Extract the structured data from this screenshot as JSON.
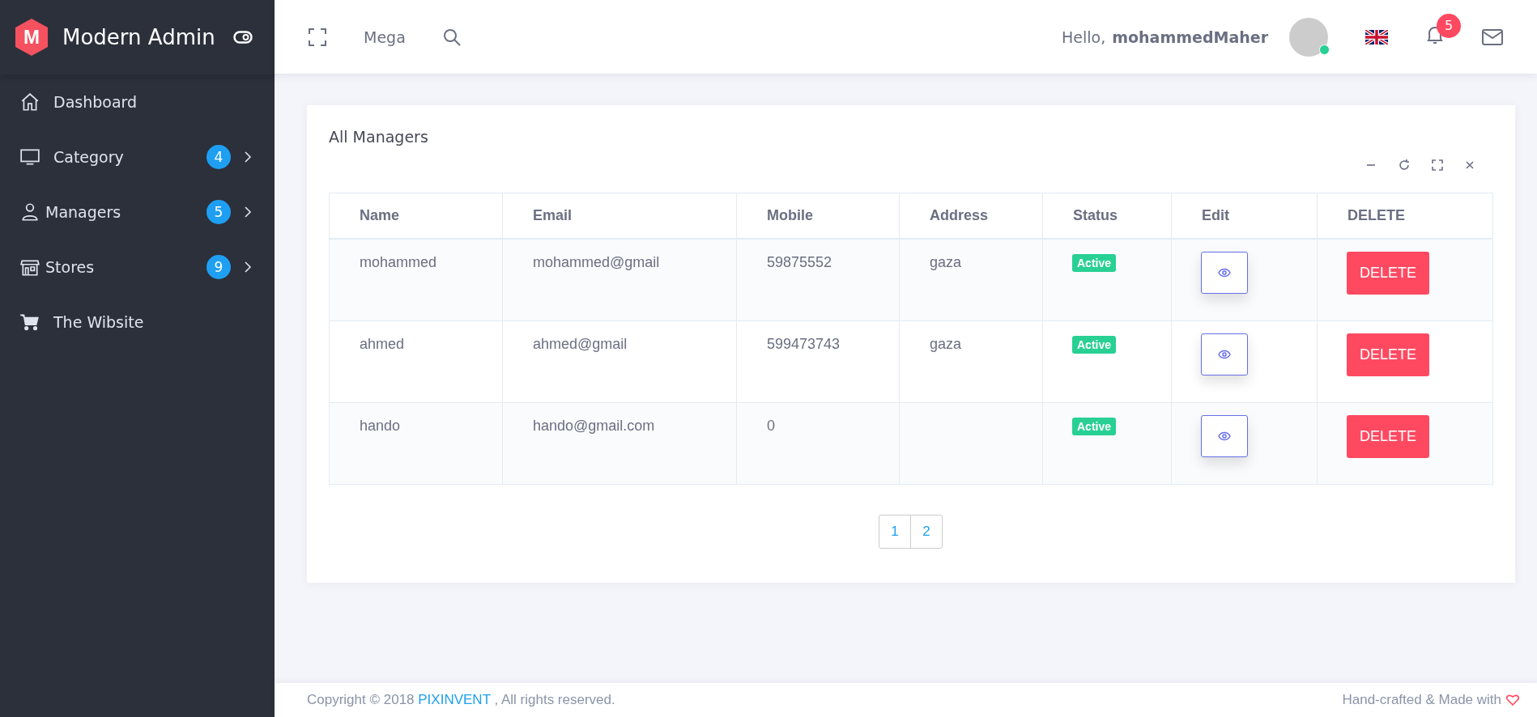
{
  "brand": {
    "logo_letter": "M",
    "name": "Modern Admin"
  },
  "sidebar": {
    "items": [
      {
        "label": "Dashboard",
        "kind": "link"
      },
      {
        "label": "Category",
        "kind": "submenu",
        "badge": "4",
        "expanded": false
      },
      {
        "label": "Managers",
        "kind": "submenu",
        "badge": "5",
        "expanded": false
      },
      {
        "label": "Stores",
        "kind": "submenu",
        "badge": "9",
        "expanded": false
      },
      {
        "label": "The Wibsite",
        "kind": "link"
      }
    ]
  },
  "header": {
    "mega": "Mega",
    "greeting": "Hello,",
    "user": "mohammedMaher",
    "online": true,
    "notifications": "5"
  },
  "card": {
    "title": "All Managers",
    "table": {
      "columns": [
        "Name",
        "Email",
        "Mobile",
        "Address",
        "Status",
        "Edit",
        "DELETE"
      ],
      "rows": [
        {
          "name": "mohammed",
          "email": "mohammed@gmail",
          "mobile": "59875552",
          "address": "gaza",
          "status": "Active",
          "delete": "DELETE"
        },
        {
          "name": "ahmed",
          "email": "ahmed@gmail",
          "mobile": "599473743",
          "address": "gaza",
          "status": "Active",
          "delete": "DELETE"
        },
        {
          "name": "hando",
          "email": "hando@gmail.com",
          "mobile": "0",
          "status": "Active",
          "delete": "DELETE"
        }
      ]
    },
    "pagination": [
      {
        "label": "1",
        "selected": false
      },
      {
        "label": "2",
        "selected": false
      }
    ]
  },
  "footer": {
    "copyright_before": "Copyright © 2018",
    "link": "PIXINVENT",
    "copyright_after": ", All rights reserved.",
    "credit": "Hand-crafted & Made with"
  }
}
